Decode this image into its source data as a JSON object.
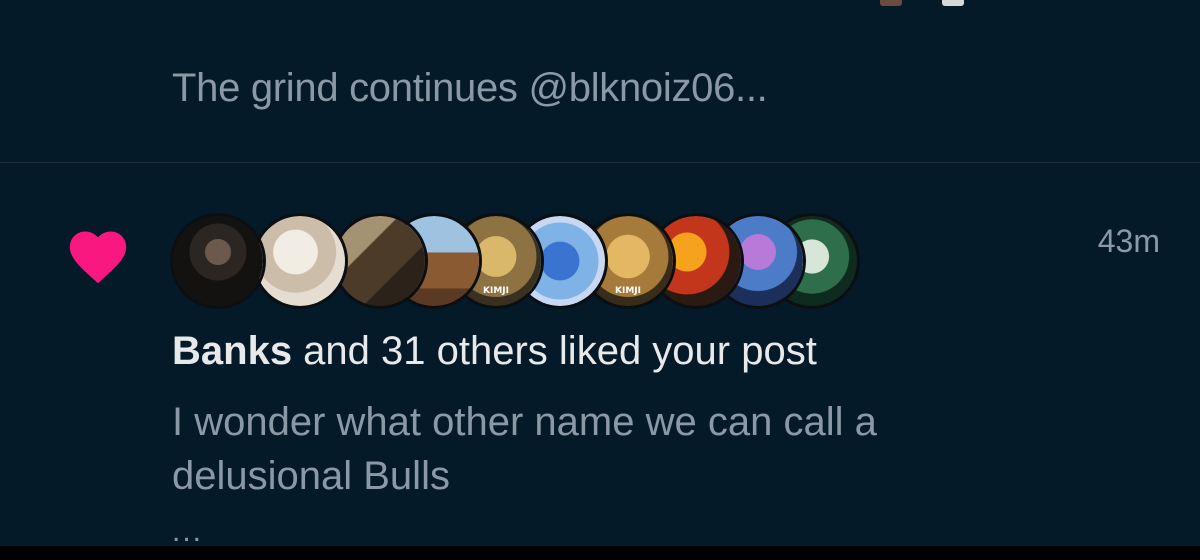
{
  "previous_notification": {
    "snippet": "The grind continues @blknoiz06..."
  },
  "like_notification": {
    "heart_color": "#F91880",
    "time": "43m",
    "actor": "Banks",
    "rest": " and 31 others liked your post",
    "post_line1": "I wonder what other name we can call a",
    "post_line2": "delusional Bulls",
    "truncation": "...",
    "avatars": [
      {
        "name": "avatar-1",
        "label": ""
      },
      {
        "name": "avatar-2",
        "label": ""
      },
      {
        "name": "avatar-3",
        "label": ""
      },
      {
        "name": "avatar-4",
        "label": ""
      },
      {
        "name": "avatar-5",
        "label": "KIMJI"
      },
      {
        "name": "avatar-6",
        "label": ""
      },
      {
        "name": "avatar-7",
        "label": "KIMJI"
      },
      {
        "name": "avatar-8",
        "label": ""
      },
      {
        "name": "avatar-9",
        "label": ""
      },
      {
        "name": "avatar-10",
        "label": ""
      }
    ]
  },
  "colors": {
    "background": "#051A28",
    "primary_text": "#E7E9EA",
    "secondary_text": "#8B98A5"
  }
}
